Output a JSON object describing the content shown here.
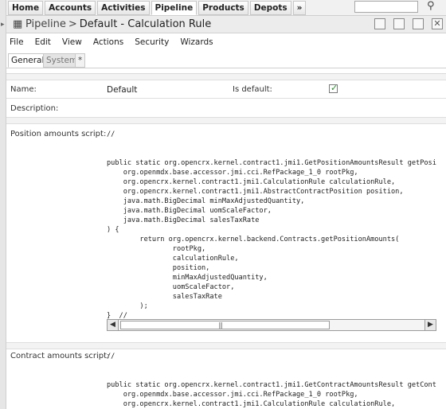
{
  "nav": {
    "tabs": [
      "Home",
      "Accounts",
      "Activities",
      "Pipeline",
      "Products",
      "Depots",
      "»"
    ],
    "active_tab": "Pipeline",
    "search_value": ""
  },
  "title": {
    "breadcrumb": "Pipeline",
    "separator": ">",
    "current": "Default - Calculation Rule"
  },
  "menu": [
    "File",
    "Edit",
    "View",
    "Actions",
    "Security",
    "Wizards"
  ],
  "tabs": {
    "general": "General",
    "system": "System",
    "more": "*"
  },
  "form": {
    "name_label": "Name:",
    "name_value": "Default",
    "is_default_label": "Is default:",
    "is_default_checked": true,
    "description_label": "Description:",
    "description_value": "",
    "position_label": "Position amounts script:",
    "position_code": [
      "//",
      "",
      "",
      "public static org.opencrx.kernel.contract1.jmi1.GetPositionAmountsResult getPositionAmounts(",
      "    org.openmdx.base.accessor.jmi.cci.RefPackage_1_0 rootPkg,",
      "    org.opencrx.kernel.contract1.jmi1.CalculationRule calculationRule,",
      "    org.opencrx.kernel.contract1.jmi1.AbstractContractPosition position,",
      "    java.math.BigDecimal minMaxAdjustedQuantity,",
      "    java.math.BigDecimal uomScaleFactor,",
      "    java.math.BigDecimal salesTaxRate",
      ") {",
      "        return org.opencrx.kernel.backend.Contracts.getPositionAmounts(",
      "                rootPkg,",
      "                calculationRule,",
      "                position,",
      "                minMaxAdjustedQuantity,",
      "                uomScaleFactor,",
      "                salesTaxRate",
      "        );",
      "}  //"
    ],
    "contract_label": "Contract amounts script:",
    "contract_code": [
      "//",
      "",
      "",
      "public static org.opencrx.kernel.contract1.jmi1.GetContractAmountsResult getContractAmounts(",
      "    org.openmdx.base.accessor.jmi.cci.RefPackage_1_0 rootPkg,",
      "    org.opencrx.kernel.contract1.jmi1.CalculationRule calculationRule,"
    ]
  },
  "icons": {
    "title": "document-icon",
    "search": "search-icon",
    "checkbox": "checkmark-icon"
  },
  "colors": {
    "check": "#2d8a2d",
    "tab_bar": "#f1f1f1"
  }
}
